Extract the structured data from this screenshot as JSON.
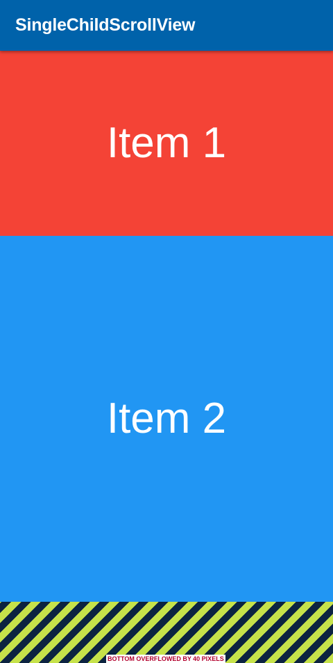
{
  "app_bar": {
    "title": "SingleChildScrollView",
    "background_color": "#0062aa"
  },
  "scroll_content": {
    "items": [
      {
        "label": "Item 1",
        "color": "#f44336"
      },
      {
        "label": "Item 2",
        "color": "#2196f3"
      }
    ]
  },
  "overflow_indicator": {
    "message": "BOTTOM OVERFLOWED BY 40 PIXELS",
    "stripe_colors": [
      "#c6e24a",
      "#0c2340"
    ],
    "text_color": "#b3002d"
  }
}
